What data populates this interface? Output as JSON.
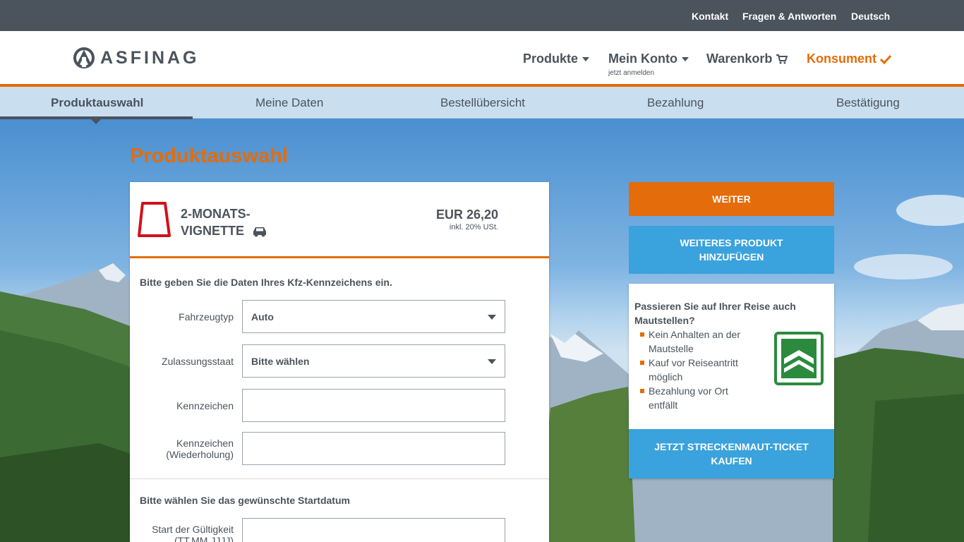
{
  "topbar": {
    "contact": "Kontakt",
    "faq": "Fragen & Antworten",
    "language": "Deutsch"
  },
  "header": {
    "logo_text": "ASFINAG",
    "nav": {
      "products": "Produkte",
      "account": "Mein Konto",
      "account_sub": "jetzt anmelden",
      "cart": "Warenkorb",
      "consumer": "Konsument"
    }
  },
  "steps": [
    "Produktauswahl",
    "Meine Daten",
    "Bestellübersicht",
    "Bezahlung",
    "Bestätigung"
  ],
  "active_step": "Produktauswahl",
  "page_title": "Produktauswahl",
  "product": {
    "name_line1": "2-MONATS-",
    "name_line2": "VIGNETTE",
    "price": "EUR 26,20",
    "price_note": "inkl. 20% USt."
  },
  "vehicle_section": {
    "title": "Bitte geben Sie die Daten Ihres Kfz-Kennzeichens ein.",
    "vehicle_type": {
      "label": "Fahrzeugtyp",
      "value": "Auto"
    },
    "registration_state": {
      "label": "Zulassungsstaat",
      "value": "Bitte wählen"
    },
    "plate": {
      "label": "Kennzeichen",
      "value": ""
    },
    "plate_repeat": {
      "label_line1": "Kennzeichen",
      "label_line2": "(Wiederholung)",
      "value": ""
    }
  },
  "date_section": {
    "title": "Bitte wählen Sie das gewünschte Startdatum",
    "start": {
      "label_line1": "Start der Gültigkeit",
      "label_line2": "(TT.MM.JJJJ)",
      "value": ""
    }
  },
  "buttons": {
    "next": "WEITER",
    "add_line1": "WEITERES PRODUKT",
    "add_line2": "HINZUFÜGEN"
  },
  "promo": {
    "title": "Passieren Sie auf Ihrer Reise auch Mautstellen?",
    "items": [
      "Kein Anhalten an der Mautstelle",
      "Kauf vor Reiseantritt möglich",
      "Bezahlung vor Ort entfällt"
    ],
    "cta_line1": "JETZT STRECKENMAUT-TICKET",
    "cta_line2": "KAUFEN"
  },
  "colors": {
    "orange": "#e46c0a",
    "blue": "#3aa2dc",
    "dark": "#4b535c",
    "green": "#2b8a3e"
  }
}
